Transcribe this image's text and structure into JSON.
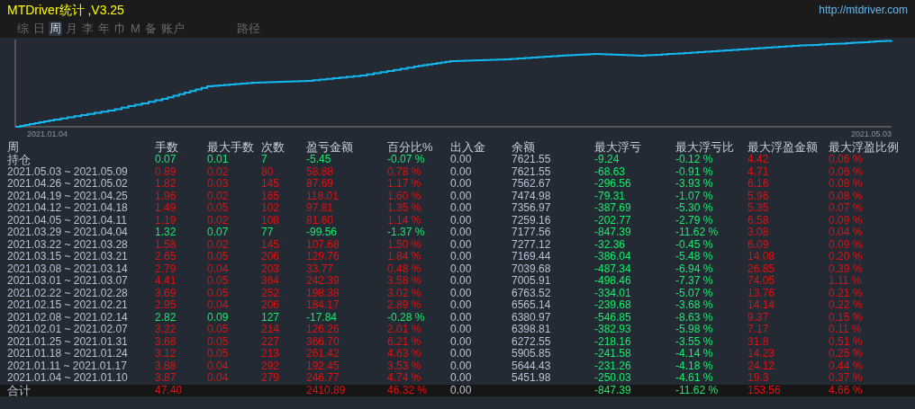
{
  "window": {
    "title": "MTDriver统计 ,V3.25",
    "url": "http://mtdriver.com"
  },
  "tabs": [
    {
      "label": "综",
      "selected": false
    },
    {
      "label": "日",
      "selected": false
    },
    {
      "label": "周",
      "selected": true
    },
    {
      "label": "月",
      "selected": false
    },
    {
      "label": "李",
      "selected": false
    },
    {
      "label": "年",
      "selected": false
    },
    {
      "label": "巾",
      "selected": false
    },
    {
      "label": "M",
      "selected": false
    },
    {
      "label": "备",
      "selected": false
    },
    {
      "label": "账户",
      "selected": false
    }
  ],
  "path_label": "路径",
  "chart": {
    "start_date": "2021.01.04",
    "end_date": "2021.05.03"
  },
  "table": {
    "columns": [
      "周",
      "手数",
      "最大手数",
      "次数",
      "盈亏金额",
      "百分比%",
      "出入金",
      "余额",
      "最大浮亏",
      "最大浮亏比",
      "最大浮盈金额",
      "最大浮盈比例"
    ],
    "rows": [
      {
        "kind": "loss",
        "cells": [
          "持仓",
          "0.07",
          "0.01",
          "7",
          "-5.45",
          "-0.07 %",
          "0.00",
          "7621.55",
          "-9.24",
          "-0.12 %",
          "4.42",
          "0.06 %"
        ]
      },
      {
        "kind": "gain",
        "cells": [
          "2021.05.03 ~ 2021.05.09",
          "0.89",
          "0.02",
          "80",
          "58.88",
          "0.78 %",
          "0.00",
          "7621.55",
          "-68.63",
          "-0.91 %",
          "4.71",
          "0.06 %"
        ]
      },
      {
        "kind": "gain",
        "cells": [
          "2021.04.26 ~ 2021.05.02",
          "1.82",
          "0.03",
          "145",
          "87.69",
          "1.17 %",
          "0.00",
          "7562.67",
          "-296.56",
          "-3.93 %",
          "6.16",
          "0.08 %"
        ]
      },
      {
        "kind": "gain",
        "cells": [
          "2021.04.19 ~ 2021.04.25",
          "1.96",
          "0.02",
          "165",
          "118.01",
          "1.60 %",
          "0.00",
          "7474.98",
          "-79.31",
          "-1.07 %",
          "5.96",
          "0.08 %"
        ]
      },
      {
        "kind": "gain",
        "cells": [
          "2021.04.12 ~ 2021.04.18",
          "1.49",
          "0.05",
          "102",
          "97.81",
          "1.35 %",
          "0.00",
          "7356.97",
          "-387.69",
          "-5.30 %",
          "5.35",
          "0.07 %"
        ]
      },
      {
        "kind": "gain",
        "cells": [
          "2021.04.05 ~ 2021.04.11",
          "1.19",
          "0.02",
          "108",
          "81.60",
          "1.14 %",
          "0.00",
          "7259.16",
          "-202.77",
          "-2.79 %",
          "6.58",
          "0.09 %"
        ]
      },
      {
        "kind": "loss",
        "cells": [
          "2021.03.29 ~ 2021.04.04",
          "1.32",
          "0.07",
          "77",
          "-99.56",
          "-1.37 %",
          "0.00",
          "7177.56",
          "-847.39",
          "-11.62 %",
          "3.08",
          "0.04 %"
        ]
      },
      {
        "kind": "gain",
        "cells": [
          "2021.03.22 ~ 2021.03.28",
          "1.58",
          "0.02",
          "145",
          "107.68",
          "1.50 %",
          "0.00",
          "7277.12",
          "-32.36",
          "-0.45 %",
          "6.09",
          "0.09 %"
        ]
      },
      {
        "kind": "gain",
        "cells": [
          "2021.03.15 ~ 2021.03.21",
          "2.65",
          "0.05",
          "206",
          "129.76",
          "1.84 %",
          "0.00",
          "7169.44",
          "-386.04",
          "-5.48 %",
          "14.08",
          "0.20 %"
        ]
      },
      {
        "kind": "gain",
        "cells": [
          "2021.03.08 ~ 2021.03.14",
          "2.79",
          "0.04",
          "203",
          "33.77",
          "0.48 %",
          "0.00",
          "7039.68",
          "-487.34",
          "-6.94 %",
          "26.85",
          "0.39 %"
        ]
      },
      {
        "kind": "gain",
        "cells": [
          "2021.03.01 ~ 2021.03.07",
          "4.41",
          "0.05",
          "364",
          "242.39",
          "3.58 %",
          "0.00",
          "7005.91",
          "-498.46",
          "-7.37 %",
          "74.05",
          "1.11 %"
        ]
      },
      {
        "kind": "gain",
        "cells": [
          "2021.02.22 ~ 2021.02.28",
          "3.69",
          "0.05",
          "252",
          "198.38",
          "3.02 %",
          "0.00",
          "6763.52",
          "-334.01",
          "-5.07 %",
          "13.76",
          "0.21 %"
        ]
      },
      {
        "kind": "gain",
        "cells": [
          "2021.02.15 ~ 2021.02.21",
          "2.95",
          "0.04",
          "206",
          "184.17",
          "2.89 %",
          "0.00",
          "6565.14",
          "-239.68",
          "-3.68 %",
          "14.14",
          "0.22 %"
        ]
      },
      {
        "kind": "loss",
        "cells": [
          "2021.02.08 ~ 2021.02.14",
          "2.82",
          "0.09",
          "127",
          "-17.84",
          "-0.28 %",
          "0.00",
          "6380.97",
          "-546.85",
          "-8.63 %",
          "9.37",
          "0.15 %"
        ]
      },
      {
        "kind": "gain",
        "cells": [
          "2021.02.01 ~ 2021.02.07",
          "3.22",
          "0.05",
          "214",
          "126.26",
          "2.01 %",
          "0.00",
          "6398.81",
          "-382.93",
          "-5.98 %",
          "7.17",
          "0.11 %"
        ]
      },
      {
        "kind": "gain",
        "cells": [
          "2021.01.25 ~ 2021.01.31",
          "3.68",
          "0.05",
          "227",
          "366.70",
          "6.21 %",
          "0.00",
          "6272.55",
          "-218.16",
          "-3.55 %",
          "31.8",
          "0.51 %"
        ]
      },
      {
        "kind": "gain",
        "cells": [
          "2021.01.18 ~ 2021.01.24",
          "3.12",
          "0.05",
          "213",
          "261.42",
          "4.63 %",
          "0.00",
          "5905.85",
          "-241.58",
          "-4.14 %",
          "14.23",
          "0.25 %"
        ]
      },
      {
        "kind": "gain",
        "cells": [
          "2021.01.11 ~ 2021.01.17",
          "3.88",
          "0.04",
          "292",
          "192.45",
          "3.53 %",
          "0.00",
          "5644.43",
          "-231.26",
          "-4.18 %",
          "24.12",
          "0.44 %"
        ]
      },
      {
        "kind": "gain",
        "cells": [
          "2021.01.04 ~ 2021.01.10",
          "3.87",
          "0.04",
          "279",
          "246.77",
          "4.74 %",
          "0.00",
          "5451.98",
          "-250.03",
          "-4.61 %",
          "19.3",
          "0.37 %"
        ]
      }
    ],
    "total": {
      "kind": "gain",
      "cells": [
        "合计",
        "47.40",
        "",
        "",
        "2410.89",
        "46.32 %",
        "0.00",
        "",
        "-847.39",
        "-11.62 %",
        "153.56",
        "4.66 %"
      ]
    }
  }
}
